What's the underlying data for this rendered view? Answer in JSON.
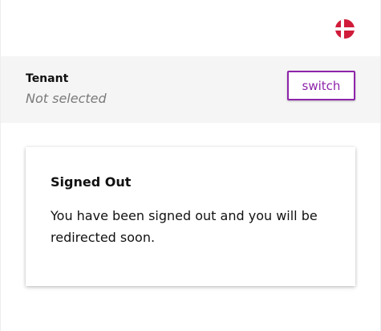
{
  "header": {
    "language_icon": "denmark-flag-icon"
  },
  "tenant": {
    "label": "Tenant",
    "value": "Not selected",
    "switch_label": "switch"
  },
  "card": {
    "title": "Signed Out",
    "message": "You have been signed out and you will be redirected soon."
  },
  "colors": {
    "accent": "#8e24aa",
    "flag_red": "#d01c3a",
    "tenant_bar_bg": "#f5f5f5"
  }
}
